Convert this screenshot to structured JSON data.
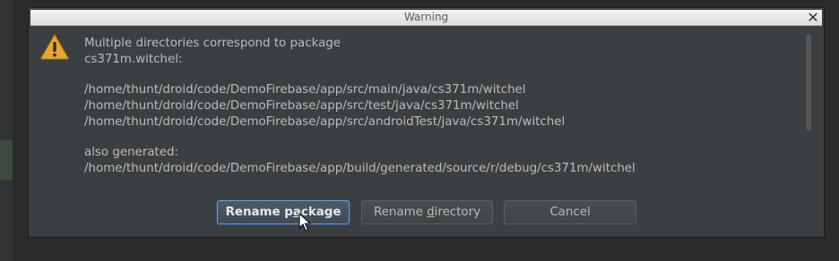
{
  "dialog": {
    "title": "Warning",
    "close_icon": "close-icon",
    "icon": "warning-icon",
    "message_lines": [
      "Multiple directories correspond to package",
      "cs371m.witchel:"
    ],
    "paths": [
      "/home/thunt/droid/code/DemoFirebase/app/src/main/java/cs371m/witchel",
      "/home/thunt/droid/code/DemoFirebase/app/src/test/java/cs371m/witchel",
      "/home/thunt/droid/code/DemoFirebase/app/src/androidTest/java/cs371m/witchel"
    ],
    "also_label": "also generated:",
    "generated_path": "/home/thunt/droid/code/DemoFirebase/app/build/generated/source/r/debug/cs371m/witchel"
  },
  "buttons": {
    "rename_package": {
      "before": "Rename p",
      "mnemonic": "a",
      "after": "ckage"
    },
    "rename_directory": {
      "before": "Rename ",
      "mnemonic": "d",
      "after": "irectory"
    },
    "cancel": "Cancel"
  },
  "colors": {
    "dialog_bg": "#3c3f41",
    "text": "#bbbbbb",
    "default_button_border": "#6d9ec3",
    "warning_icon": "#e8a631"
  }
}
